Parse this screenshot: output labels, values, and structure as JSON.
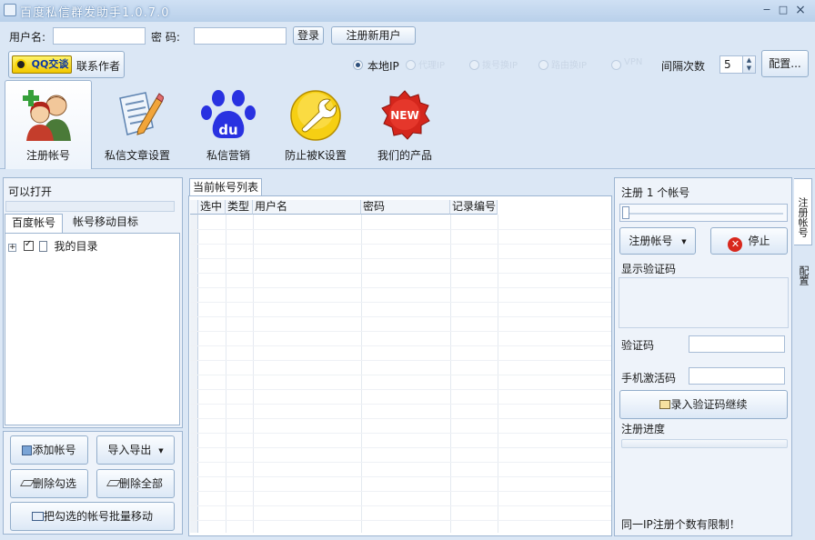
{
  "window": {
    "title": "百度私信群发助手1.0.7.0",
    "controls": [
      "−",
      "□",
      "×"
    ]
  },
  "login": {
    "username_label": "用户名:",
    "username_value": "",
    "password_label": "密  码:",
    "password_value": "",
    "login_button": "登录",
    "register_button": "注册新用户"
  },
  "contact": {
    "qq_badge": "QQ交谈",
    "label": "联系作者"
  },
  "proxy": {
    "selected": "本地IP",
    "other_options": [
      "代理IP",
      "拨号换IP",
      "路由换IP",
      "VPN"
    ]
  },
  "interval": {
    "label": "间隔次数",
    "value": "5"
  },
  "config_button": "配置...",
  "ribbon": {
    "tabs": [
      {
        "label": "注册帐号",
        "icon": "users-add-icon",
        "active": true
      },
      {
        "label": "私信文章设置",
        "icon": "document-edit-icon",
        "active": false
      },
      {
        "label": "私信营销",
        "icon": "baidu-paw-icon",
        "active": false
      },
      {
        "label": "防止被K设置",
        "icon": "wrench-icon",
        "active": false
      },
      {
        "label": "我们的产品",
        "icon": "new-badge-icon",
        "active": false
      }
    ]
  },
  "left_panel": {
    "header": "可以打开",
    "tabs": [
      "百度帐号",
      "帐号移动目标"
    ],
    "tree": {
      "expander": "+",
      "root_label": "我的目录",
      "checked": true
    },
    "buttons": {
      "add": "添加帐号",
      "import_export": "导入导出",
      "delete_checked": "删除勾选",
      "delete_all": "删除全部",
      "batch_move": "把勾选的帐号批量移动"
    }
  },
  "account_list": {
    "tab": "当前帐号列表",
    "columns": [
      "选中",
      "类型",
      "用户名",
      "密码",
      "记录编号"
    ],
    "rows": []
  },
  "register_panel": {
    "count_label": "注册 1 个帐号",
    "register_button": "注册帐号",
    "stop_button": "停止",
    "captcha_display_label": "显示验证码",
    "captcha_label": "验证码",
    "captcha_value": "",
    "sms_label": "手机激活码",
    "sms_value": "",
    "submit_button": "录入验证码继续",
    "progress_label": "注册进度",
    "progress_value": 0,
    "notice": "同一IP注册个数有限制！"
  },
  "side_tabs": [
    "注册帐号",
    "配置"
  ]
}
